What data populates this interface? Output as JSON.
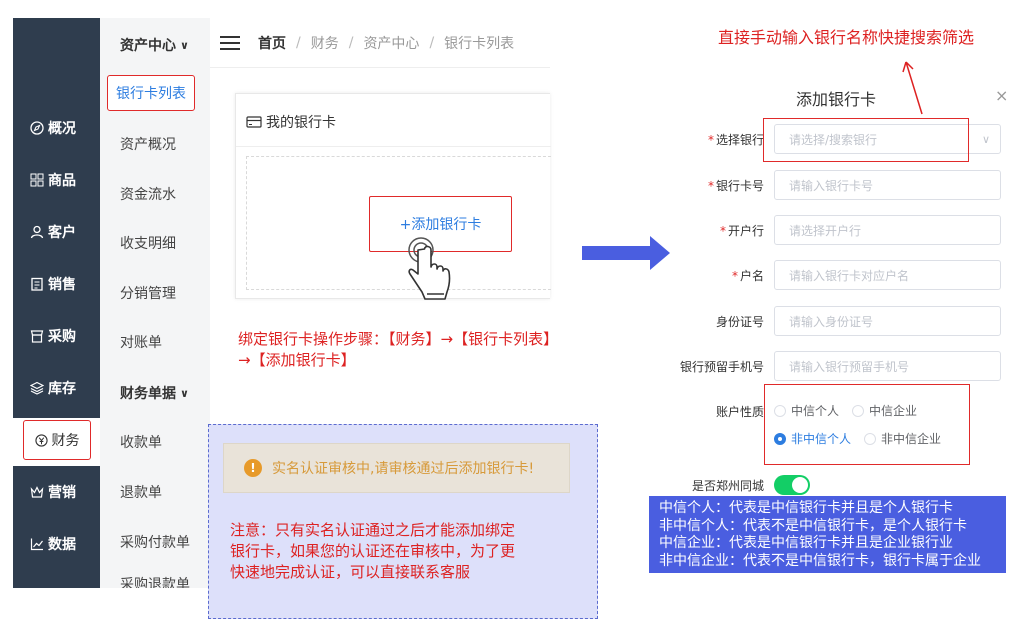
{
  "sidebar": {
    "items": [
      {
        "label": "概况",
        "icon": "compass-icon"
      },
      {
        "label": "商品",
        "icon": "grid-icon"
      },
      {
        "label": "客户",
        "icon": "user-icon"
      },
      {
        "label": "销售",
        "icon": "clipboard-icon"
      },
      {
        "label": "采购",
        "icon": "shop-icon"
      },
      {
        "label": "库存",
        "icon": "layers-icon"
      },
      {
        "label": "财务",
        "icon": "yen-icon"
      },
      {
        "label": "营销",
        "icon": "crown-icon"
      },
      {
        "label": "数据",
        "icon": "chart-icon"
      }
    ]
  },
  "submenu": {
    "group1": "资产中心",
    "items1": [
      "银行卡列表",
      "资产概况",
      "资金流水",
      "收支明细",
      "分销管理",
      "对账单"
    ],
    "group2": "财务单据",
    "items2": [
      "收款单",
      "退款单",
      "采购付款单",
      "采购退款单"
    ]
  },
  "breadcrumb": {
    "home": "首页",
    "l1": "财务",
    "l2": "资产中心",
    "l3": "银行卡列表",
    "sep": "/"
  },
  "panel": {
    "title": "我的银行卡",
    "add_button": "+添加银行卡"
  },
  "notes": {
    "steps_line1": "绑定银行卡操作步骤：【财务】→【银行卡列表】",
    "steps_line2": "→【添加银行卡】",
    "warning": "实名认证审核中,请审核通过后添加银行卡!",
    "attention_line1": "注意：只有实名认证通过之后才能添加绑定",
    "attention_line2": "银行卡，如果您的认证还在审核中，为了更",
    "attention_line3": "快速地完成认证，可以直接联系客服",
    "top": "直接手动输入银行名称快捷搜索筛选"
  },
  "dialog": {
    "title": "添加银行卡",
    "close": "×",
    "fields": [
      {
        "label": "选择银行",
        "required": true,
        "placeholder": "请选择/搜索银行"
      },
      {
        "label": "银行卡号",
        "required": true,
        "placeholder": "请输入银行卡号"
      },
      {
        "label": "开户行",
        "required": true,
        "placeholder": "请选择开户行"
      },
      {
        "label": "户名",
        "required": true,
        "placeholder": "请输入银行卡对应户名"
      },
      {
        "label": "身份证号",
        "required": false,
        "placeholder": "请输入身份证号"
      },
      {
        "label": "银行预留手机号",
        "required": false,
        "placeholder": "请输入银行预留手机号"
      }
    ],
    "account_type_label": "账户性质",
    "account_options": [
      "中信个人",
      "中信企业",
      "非中信个人",
      "非中信企业"
    ],
    "account_selected": "非中信个人",
    "same_city_label": "是否郑州同城",
    "same_city_on": true
  },
  "legend": [
    "中信个人：代表是中信银行卡并且是个人银行卡",
    "非中信个人：代表不是中信银行卡，是个人银行卡",
    "中信企业：代表是中信银行卡并且是企业银行业",
    "非中信企业：代表不是中信银行卡，银行卡属于企业"
  ],
  "colors": {
    "sidebar_bg": "#2f3d4e",
    "accent_blue": "#2d7de0",
    "annotation_red": "#e02a2a",
    "toggle_green": "#13ce66",
    "legend_bg": "#4a5ee0"
  }
}
